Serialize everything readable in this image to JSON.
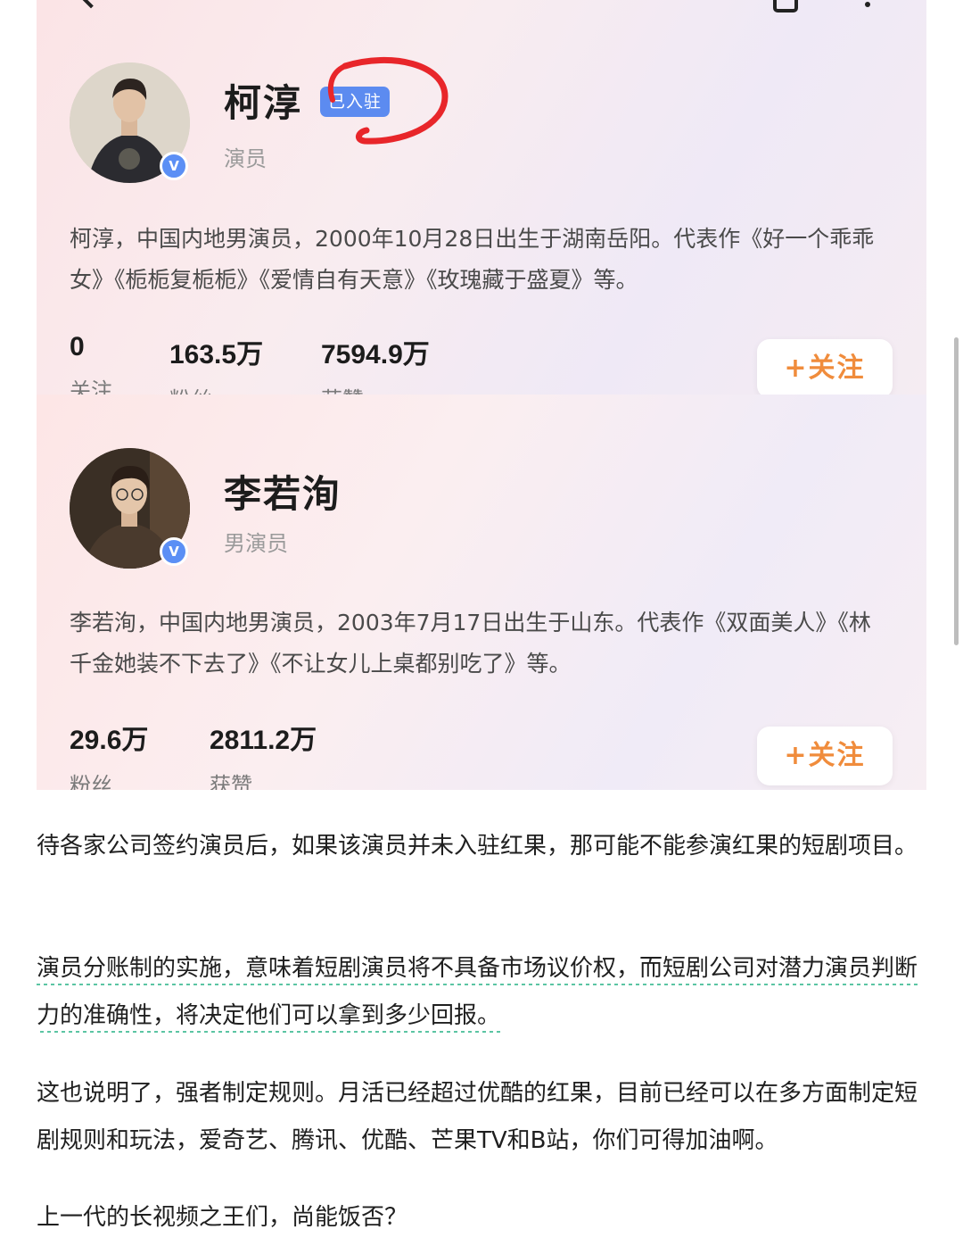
{
  "icons": {
    "back": "chevron-left-icon",
    "share": "share-icon",
    "more": "more-vertical-icon",
    "verified": "verified-badge-icon"
  },
  "colors": {
    "badge": "#5c8bf0",
    "follow": "#f08c3c",
    "highlight": "#e8262a",
    "underline": "#5bc5a3"
  },
  "profiles": [
    {
      "name": "柯淳",
      "badge": "已入驻",
      "role": "演员",
      "bio": "柯淳，中国内地男演员，2000年10月28日出生于湖南岳阳。代表作《好一个乖乖女》《栀栀复栀栀》《爱情自有天意》《玫瑰藏于盛夏》等。",
      "stats": [
        {
          "value": "0",
          "label": "关注"
        },
        {
          "value": "163.5万",
          "label": "粉丝"
        },
        {
          "value": "7594.9万",
          "label": "获赞"
        }
      ],
      "follow_label": "+关注"
    },
    {
      "name": "李若洵",
      "role": "男演员",
      "bio": "李若洵，中国内地男演员，2003年7月17日出生于山东。代表作《双面美人》《林千金她装不下去了》《不让女儿上桌都别吃了》等。",
      "stats": [
        {
          "value": "29.6万",
          "label": "粉丝"
        },
        {
          "value": "2811.2万",
          "label": "获赞"
        }
      ],
      "follow_label": "+关注"
    }
  ],
  "article": {
    "paragraphs": [
      "待各家公司签约演员后，如果该演员并未入驻红果，那可能不能参演红果的短剧项目。",
      "演员分账制的实施，意味着短剧演员将不具备市场议价权，而短剧公司对潜力演员判断力的准确性，将决定他们可以拿到多少回报。",
      "这也说明了，强者制定规则。月活已经超过优酷的红果，目前已经可以在多方面制定短剧规则和玩法，爱奇艺、腾讯、优酷、芒果TV和B站，你们可得加油啊。",
      "上一代的长视频之王们，尚能饭否？"
    ]
  }
}
